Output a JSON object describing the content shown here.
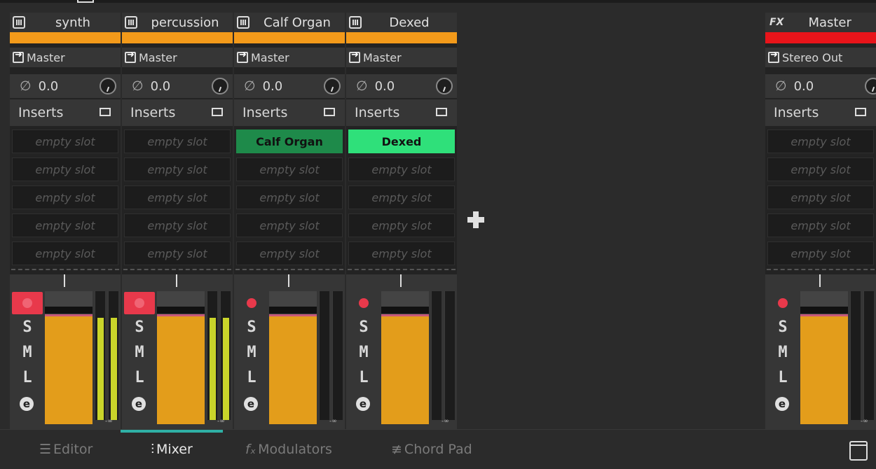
{
  "channels": [
    {
      "name": "synth",
      "route": "Master",
      "gain": "0.0",
      "inserts_label": "Inserts",
      "slots": [
        "empty slot",
        "empty slot",
        "empty slot",
        "empty slot",
        "empty slot"
      ],
      "record_armed": true,
      "solo": "S",
      "mute": "M",
      "listen": "L",
      "meter_level": 0.75,
      "meter_value": "-∞",
      "color": "#f39a1a"
    },
    {
      "name": "percussion",
      "route": "Master",
      "gain": "0.0",
      "inserts_label": "Inserts",
      "slots": [
        "empty slot",
        "empty slot",
        "empty slot",
        "empty slot",
        "empty slot"
      ],
      "record_armed": true,
      "solo": "S",
      "mute": "M",
      "listen": "L",
      "meter_level": 0.75,
      "meter_value": "-∞",
      "color": "#f39a1a"
    },
    {
      "name": "Calf Organ",
      "route": "Master",
      "gain": "0.0",
      "inserts_label": "Inserts",
      "slots": [
        "Calf Organ",
        "empty slot",
        "empty slot",
        "empty slot",
        "empty slot"
      ],
      "plugin_color": "#1e8a4a",
      "record_armed": false,
      "solo": "S",
      "mute": "M",
      "listen": "L",
      "meter_level": 0,
      "meter_value": "-∞",
      "color": "#f39a1a"
    },
    {
      "name": "Dexed",
      "route": "Master",
      "gain": "0.0",
      "inserts_label": "Inserts",
      "slots": [
        "Dexed",
        "empty slot",
        "empty slot",
        "empty slot",
        "empty slot"
      ],
      "plugin_color": "#2fe07a",
      "record_armed": false,
      "solo": "S",
      "mute": "M",
      "listen": "L",
      "meter_level": 0,
      "meter_value": "-∞",
      "color": "#f39a1a"
    }
  ],
  "master": {
    "name": "Master",
    "fx_label": "FX",
    "route": "Stereo Out",
    "gain": "0.0",
    "inserts_label": "Inserts",
    "slots": [
      "empty slot",
      "empty slot",
      "empty slot",
      "empty slot",
      "empty slot"
    ],
    "solo": "S",
    "mute": "M",
    "listen": "L",
    "meter_value": "-∞",
    "color": "#e8141a"
  },
  "tabs": [
    {
      "label": "Editor",
      "icon": "list-icon",
      "active": false
    },
    {
      "label": "Mixer",
      "icon": "mixer-icon",
      "active": true
    },
    {
      "label": "Modulators",
      "icon": "fx-icon",
      "active": false
    },
    {
      "label": "Chord Pad",
      "icon": "chord-icon",
      "active": false
    }
  ],
  "colors": {
    "record_active_bg": "#e8394b",
    "record_dot": "#e8394b",
    "fader": "#e39d1b",
    "meter": "#c9d42a",
    "accent": "#2fb0a5"
  }
}
